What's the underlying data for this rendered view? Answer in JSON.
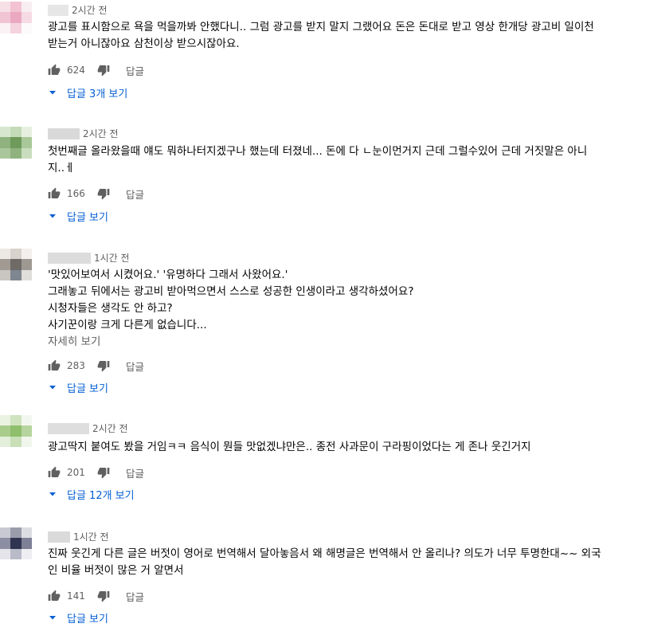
{
  "colors": {
    "link": "#065fd4",
    "meta": "#606060",
    "text": "#030303"
  },
  "comments": [
    {
      "time": "2시간 전",
      "avatar": [
        "#f7dfe6",
        "#f2c3d2",
        "#f8eef1",
        "#f1c4d4",
        "#eaa9c0",
        "#f6dbe4",
        "#fbf2f5",
        "#f5d3df",
        "#fdfafb"
      ],
      "name_color": "#e6e6e6",
      "lines": [
        "광고를 표시함으로 욕을 먹을까봐 안했다니.. 그럼 광고를 받지 말지 그랬어요 돈은 돈대로 받고 영상 한개당 광고비 일이천",
        "받는거 아니잖아요 삼천이상 받으시잖아요."
      ],
      "more": "",
      "likes": "624",
      "reply_label": "답글",
      "view_replies": "답글 3개 보기"
    },
    {
      "time": "2시간 전",
      "avatar": [
        "#d7e7cf",
        "#c3dbb6",
        "#e6f0e0",
        "#8fb27e",
        "#6e9a5b",
        "#a8c899",
        "#a9c79a",
        "#8fb27e",
        "#c8ddbd"
      ],
      "name_color": "#d9d9d9",
      "lines": [
        "첫번째글 올라왔을때 얘도 뭐하나터지겠구나 했는데 터졌네... 돈에 다 ㄴ눈이먼거지 근데 그럴수있어 근데 거짓말은 아니",
        "지..ㅔ"
      ],
      "more": "",
      "likes": "166",
      "reply_label": "답글",
      "view_replies": "답글 보기"
    },
    {
      "time": "1시간 전",
      "avatar": [
        "#ece9e5",
        "#d8d2cc",
        "#f2efec",
        "#a19a92",
        "#6e6a66",
        "#9d9892",
        "#c9c6c2",
        "#7e8690",
        "#e0dedb"
      ],
      "name_color": "#dcdcdc",
      "lines": [
        "'맛있어보여서 시켰어요.' '유명하다 그래서 사왔어요.'",
        "그래놓고 뒤에서는 광고비 받아먹으면서 스스로 성공한 인생이라고 생각하셨어요?",
        "시청자들은 생각도 안 하고?",
        "사기꾼이랑 크게 다른게 없습니다..."
      ],
      "more": "자세히 보기",
      "likes": "283",
      "reply_label": "답글",
      "view_replies": "답글 보기"
    },
    {
      "time": "2시간 전",
      "avatar": [
        "#eaf2e2",
        "#cfe3bf",
        "#f3f8ef",
        "#a9cc8c",
        "#8fbe6c",
        "#b6d49e",
        "#e3eedb",
        "#c9dfb8",
        "#f1f6ec"
      ],
      "name_color": "#dedede",
      "lines": [
        "광고딱지 붙여도 봤을 거임ㅋㅋ 음식이 뭔들 맛없겠냐만은.. 종전 사과문이 구라핑이었다는 게 존나 웃긴거지"
      ],
      "more": "",
      "likes": "201",
      "reply_label": "답글",
      "view_replies": "답글 12개 보기"
    },
    {
      "time": "1시간 전",
      "avatar": [
        "#c9c9d3",
        "#9a9cab",
        "#dcdce3",
        "#8c8fa3",
        "#2f3550",
        "#7d8096",
        "#e4e4ea",
        "#b9bbc8",
        "#eeeef2"
      ],
      "name_color": "#dadada",
      "lines": [
        "진짜 웃긴게 다른 글은 버젓이 영어로 번역해서 달아놓음서 왜 해명글은 번역해서 안 올리나? 의도가 너무 투명한대~~ 외국",
        "인 비율 버젓이 많은 거 알면서"
      ],
      "more": "",
      "likes": "141",
      "reply_label": "답글",
      "view_replies": "답글 보기"
    }
  ]
}
